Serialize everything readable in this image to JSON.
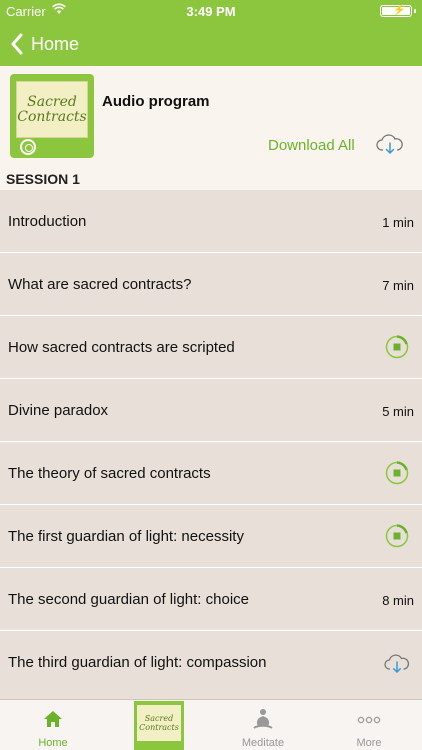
{
  "status_bar": {
    "carrier": "Carrier",
    "time": "3:49 PM"
  },
  "nav": {
    "back_label": "Home"
  },
  "program": {
    "cover_text_line1": "Sacred",
    "cover_text_line2": "Contracts",
    "title": "Audio program",
    "download_all_label": "Download All",
    "session_label": "SESSION 1"
  },
  "tracks": [
    {
      "title": "Introduction",
      "duration": "1 min",
      "state": "duration"
    },
    {
      "title": "What are sacred contracts?",
      "duration": "7 min",
      "state": "duration"
    },
    {
      "title": "How sacred contracts are scripted",
      "duration": "",
      "state": "downloading"
    },
    {
      "title": "Divine paradox",
      "duration": "5 min",
      "state": "duration"
    },
    {
      "title": "The theory of sacred contracts",
      "duration": "",
      "state": "downloading"
    },
    {
      "title": "The first guardian of light: necessity",
      "duration": "",
      "state": "downloading"
    },
    {
      "title": "The second guardian of light: choice",
      "duration": "8 min",
      "state": "duration"
    },
    {
      "title": "The third guardian of light: compassion",
      "duration": "",
      "state": "download"
    }
  ],
  "tabs": {
    "home": "Home",
    "program_thumb_line1": "Sacred",
    "program_thumb_line2": "Contracts",
    "meditate": "Meditate",
    "more": "More"
  },
  "colors": {
    "accent": "#8cc63f",
    "accent_text": "#6bb22b",
    "list_bg": "#e8e0d8",
    "header_bg": "#faf4ee",
    "cloud_arrow": "#3a9ad9"
  }
}
